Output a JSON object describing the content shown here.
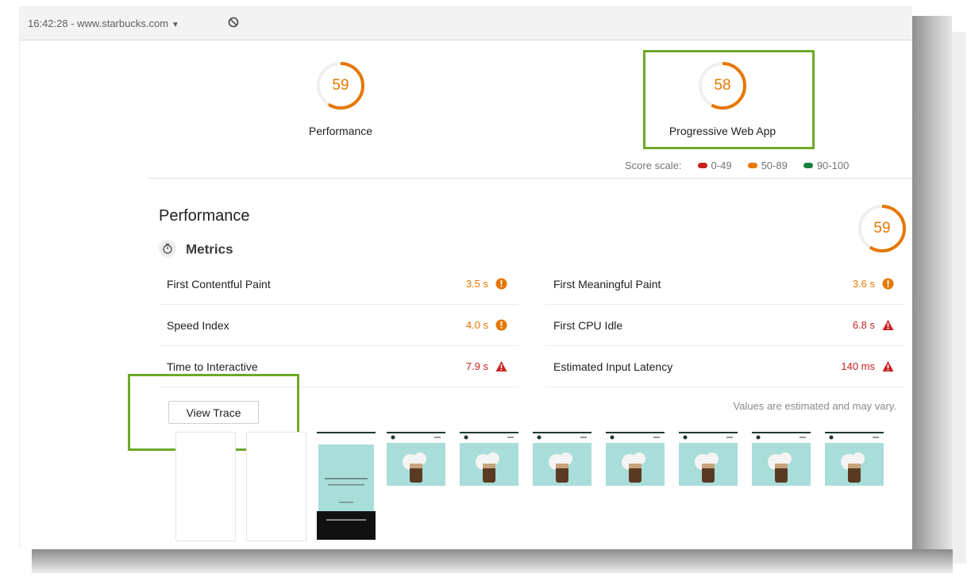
{
  "topbar": {
    "timestamp": "16:42:28 - www.starbucks.com"
  },
  "categories": [
    {
      "label": "Performance",
      "score": "59"
    },
    {
      "label": "Progressive Web App",
      "score": "58"
    }
  ],
  "score_scale": {
    "label": "Score scale:",
    "ranges": [
      {
        "text": "0-49",
        "color": "#c7221f"
      },
      {
        "text": "50-89",
        "color": "#e67700"
      },
      {
        "text": "90-100",
        "color": "#178239"
      }
    ]
  },
  "performance": {
    "title": "Performance",
    "score": "59",
    "metrics_title": "Metrics",
    "metrics": [
      {
        "name": "First Contentful Paint",
        "value": "3.5 s",
        "status": "average"
      },
      {
        "name": "First Meaningful Paint",
        "value": "3.6 s",
        "status": "average"
      },
      {
        "name": "Speed Index",
        "value": "4.0 s",
        "status": "average"
      },
      {
        "name": "First CPU Idle",
        "value": "6.8 s",
        "status": "fail"
      },
      {
        "name": "Time to Interactive",
        "value": "7.9 s",
        "status": "fail"
      },
      {
        "name": "Estimated Input Latency",
        "value": "140 ms",
        "status": "fail"
      }
    ],
    "view_trace_label": "View Trace",
    "estimate_note": "Values are estimated and may vary."
  },
  "colors": {
    "average": "#e67700",
    "fail": "#c7221f",
    "highlight": "#6fa82a",
    "thumb_bg": "#a9ddd9"
  },
  "icons": [
    "block-icon",
    "stopwatch-icon",
    "info-circle-icon",
    "warning-triangle-icon"
  ]
}
